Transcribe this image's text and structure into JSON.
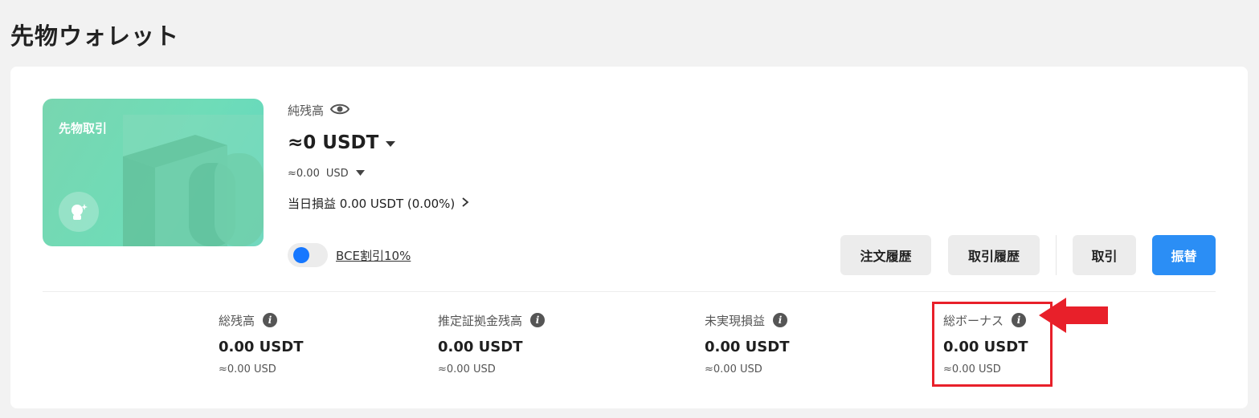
{
  "page": {
    "title": "先物ウォレット"
  },
  "card": {
    "label": "先物取引",
    "icon": "astronaut-sparkle-icon"
  },
  "balance": {
    "net_label": "純残高",
    "main_value": "≈0",
    "main_unit": "USDT",
    "sub_value": "≈0.00",
    "sub_unit": "USD",
    "pnl_text": "当日損益 0.00 USDT (0.00%)"
  },
  "discount": {
    "label": "BCE割引10%"
  },
  "buttons": {
    "order_history": "注文履歴",
    "trade_history": "取引履歴",
    "trade": "取引",
    "transfer": "振替"
  },
  "stats": [
    {
      "label": "総残高",
      "value": "0.00 USDT",
      "sub": "≈0.00 USD"
    },
    {
      "label": "推定証拠金残高",
      "value": "0.00 USDT",
      "sub": "≈0.00 USD"
    },
    {
      "label": "未実現損益",
      "value": "0.00 USDT",
      "sub": "≈0.00 USD"
    },
    {
      "label": "総ボーナス",
      "value": "0.00 USDT",
      "sub": "≈0.00 USD"
    }
  ],
  "colors": {
    "accent": "#2b8ef5",
    "toggle": "#1677ff",
    "highlight": "#e8202a",
    "card": "#6fdcb8"
  }
}
